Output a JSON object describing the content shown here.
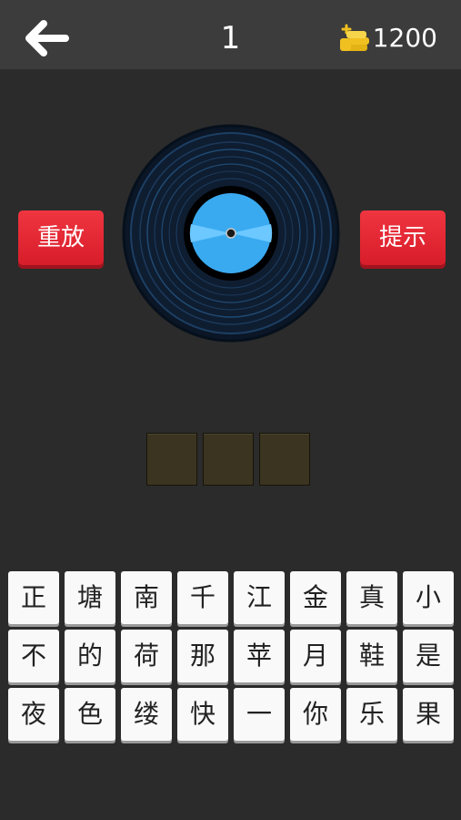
{
  "header": {
    "back_icon": "back-arrow-icon",
    "level": "1",
    "coins_icon": "coin-stack-icon",
    "coins": "1200"
  },
  "buttons": {
    "replay": "重放",
    "hint": "提示"
  },
  "record": {
    "icon": "vinyl-record-icon",
    "colors": {
      "disc": "#0f1d31",
      "groove": "#1f4a72",
      "label": "#3aaaf0"
    }
  },
  "answer": {
    "slot_count": 3,
    "slots": [
      "",
      "",
      ""
    ]
  },
  "tiles": [
    [
      "正",
      "塘",
      "南",
      "千",
      "江",
      "金",
      "真",
      "小"
    ],
    [
      "不",
      "的",
      "荷",
      "那",
      "苹",
      "月",
      "鞋",
      "是"
    ],
    [
      "夜",
      "色",
      "缕",
      "快",
      "一",
      "你",
      "乐",
      "果"
    ]
  ],
  "colors": {
    "background": "#2b2b2b",
    "topbar": "#3c3c3c",
    "button_red": "#e52733",
    "coin_gold": "#f0c020",
    "slot": "#3b3420",
    "tile": "#f9f9f9"
  }
}
